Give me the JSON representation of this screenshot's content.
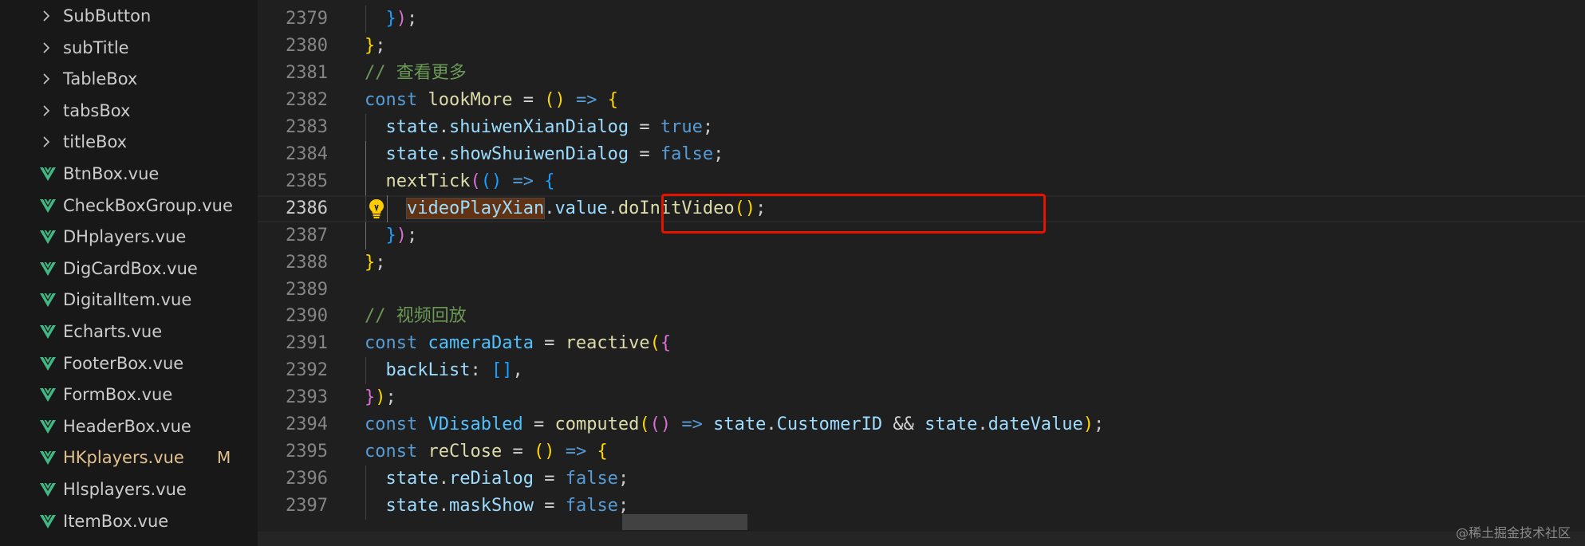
{
  "sidebar": {
    "items": [
      {
        "label": "SubButton",
        "kind": "folder"
      },
      {
        "label": "subTitle",
        "kind": "folder"
      },
      {
        "label": "TableBox",
        "kind": "folder"
      },
      {
        "label": "tabsBox",
        "kind": "folder"
      },
      {
        "label": "titleBox",
        "kind": "folder"
      },
      {
        "label": "BtnBox.vue",
        "kind": "vue"
      },
      {
        "label": "CheckBoxGroup.vue",
        "kind": "vue"
      },
      {
        "label": "DHplayers.vue",
        "kind": "vue"
      },
      {
        "label": "DigCardBox.vue",
        "kind": "vue"
      },
      {
        "label": "DigitalItem.vue",
        "kind": "vue"
      },
      {
        "label": "Echarts.vue",
        "kind": "vue"
      },
      {
        "label": "FooterBox.vue",
        "kind": "vue"
      },
      {
        "label": "FormBox.vue",
        "kind": "vue"
      },
      {
        "label": "HeaderBox.vue",
        "kind": "vue"
      },
      {
        "label": "HKplayers.vue",
        "kind": "vue",
        "modified": true,
        "badge": "M"
      },
      {
        "label": "Hlsplayers.vue",
        "kind": "vue"
      },
      {
        "label": "ItemBox.vue",
        "kind": "vue"
      }
    ]
  },
  "editor": {
    "lines": [
      {
        "n": "2379",
        "indent": 1,
        "tokens": [
          [
            "}",
            "p3"
          ],
          [
            ")",
            "p2"
          ],
          [
            ";",
            "pl"
          ]
        ]
      },
      {
        "n": "2380",
        "indent": 0,
        "tokens": [
          [
            "}",
            "p1"
          ],
          [
            ";",
            "pl"
          ]
        ]
      },
      {
        "n": "2381",
        "indent": 0,
        "tokens": [
          [
            "// 查看更多",
            "cm"
          ]
        ]
      },
      {
        "n": "2382",
        "indent": 0,
        "tokens": [
          [
            "const",
            "kw"
          ],
          [
            " ",
            "pl"
          ],
          [
            "lookMore",
            "fn"
          ],
          [
            " = ",
            "op"
          ],
          [
            "()",
            "p1"
          ],
          [
            " ",
            "pl"
          ],
          [
            "=>",
            "kw"
          ],
          [
            " ",
            "pl"
          ],
          [
            "{",
            "p1"
          ]
        ]
      },
      {
        "n": "2383",
        "indent": 1,
        "tokens": [
          [
            "state",
            "var"
          ],
          [
            ".",
            "pl"
          ],
          [
            "shuiwenXianDialog",
            "var"
          ],
          [
            " = ",
            "op"
          ],
          [
            "true",
            "kw"
          ],
          [
            ";",
            "pl"
          ]
        ]
      },
      {
        "n": "2384",
        "indent": 1,
        "tokens": [
          [
            "state",
            "var"
          ],
          [
            ".",
            "pl"
          ],
          [
            "showShuiwenDialog",
            "var"
          ],
          [
            " = ",
            "op"
          ],
          [
            "false",
            "kw"
          ],
          [
            ";",
            "pl"
          ]
        ]
      },
      {
        "n": "2385",
        "indent": 1,
        "tokens": [
          [
            "nextTick",
            "fn"
          ],
          [
            "(",
            "p2"
          ],
          [
            "()",
            "p3"
          ],
          [
            " ",
            "pl"
          ],
          [
            "=>",
            "kw"
          ],
          [
            " ",
            "pl"
          ],
          [
            "{",
            "p3"
          ]
        ]
      },
      {
        "n": "2386",
        "indent": 2,
        "current": true,
        "tokens": [
          [
            "videoPlayXian",
            "var",
            "hl"
          ],
          [
            ".",
            "pl"
          ],
          [
            "value",
            "var"
          ],
          [
            ".",
            "pl"
          ],
          [
            "doInitVideo",
            "fn"
          ],
          [
            "()",
            "p1"
          ],
          [
            ";",
            "pl"
          ]
        ]
      },
      {
        "n": "2387",
        "indent": 1,
        "tokens": [
          [
            "}",
            "p3"
          ],
          [
            ")",
            "p2"
          ],
          [
            ";",
            "pl"
          ]
        ]
      },
      {
        "n": "2388",
        "indent": 0,
        "tokens": [
          [
            "}",
            "p1"
          ],
          [
            ";",
            "pl"
          ]
        ]
      },
      {
        "n": "2389",
        "indent": 0,
        "tokens": []
      },
      {
        "n": "2390",
        "indent": 0,
        "tokens": [
          [
            "// 视频回放",
            "cm"
          ]
        ]
      },
      {
        "n": "2391",
        "indent": 0,
        "tokens": [
          [
            "const",
            "kw"
          ],
          [
            " ",
            "pl"
          ],
          [
            "cameraData",
            "cst"
          ],
          [
            " = ",
            "op"
          ],
          [
            "reactive",
            "fn"
          ],
          [
            "(",
            "p1"
          ],
          [
            "{",
            "p2"
          ]
        ]
      },
      {
        "n": "2392",
        "indent": 1,
        "tokens": [
          [
            "backList",
            "var"
          ],
          [
            ": ",
            "pl"
          ],
          [
            "[]",
            "p3"
          ],
          [
            ",",
            "pl"
          ]
        ]
      },
      {
        "n": "2393",
        "indent": 0,
        "tokens": [
          [
            "}",
            "p2"
          ],
          [
            ")",
            "p1"
          ],
          [
            ";",
            "pl"
          ]
        ]
      },
      {
        "n": "2394",
        "indent": 0,
        "tokens": [
          [
            "const",
            "kw"
          ],
          [
            " ",
            "pl"
          ],
          [
            "VDisabled",
            "cst"
          ],
          [
            " = ",
            "op"
          ],
          [
            "computed",
            "fn"
          ],
          [
            "(",
            "p1"
          ],
          [
            "()",
            "p2"
          ],
          [
            " ",
            "pl"
          ],
          [
            "=>",
            "kw"
          ],
          [
            " ",
            "pl"
          ],
          [
            "state",
            "var"
          ],
          [
            ".",
            "pl"
          ],
          [
            "CustomerID",
            "var"
          ],
          [
            " && ",
            "op"
          ],
          [
            "state",
            "var"
          ],
          [
            ".",
            "pl"
          ],
          [
            "dateValue",
            "var"
          ],
          [
            ")",
            "p1"
          ],
          [
            ";",
            "pl"
          ]
        ]
      },
      {
        "n": "2395",
        "indent": 0,
        "tokens": [
          [
            "const",
            "kw"
          ],
          [
            " ",
            "pl"
          ],
          [
            "reClose",
            "fn"
          ],
          [
            " = ",
            "op"
          ],
          [
            "()",
            "p1"
          ],
          [
            " ",
            "pl"
          ],
          [
            "=>",
            "kw"
          ],
          [
            " ",
            "pl"
          ],
          [
            "{",
            "p1"
          ]
        ]
      },
      {
        "n": "2396",
        "indent": 1,
        "tokens": [
          [
            "state",
            "var"
          ],
          [
            ".",
            "pl"
          ],
          [
            "reDialog",
            "var"
          ],
          [
            " = ",
            "op"
          ],
          [
            "false",
            "kw"
          ],
          [
            ";",
            "pl"
          ]
        ]
      },
      {
        "n": "2397",
        "indent": 1,
        "tokens": [
          [
            "state",
            "var"
          ],
          [
            ".",
            "pl"
          ],
          [
            "maskShow",
            "var"
          ],
          [
            " = ",
            "op"
          ],
          [
            "false",
            "kw"
          ],
          [
            ";",
            "pl"
          ]
        ]
      }
    ]
  },
  "watermark": "@稀土掘金技术社区",
  "colors": {
    "accent_red": "#e51400",
    "vue_green": "#41b883",
    "modified": "#e2c08d"
  }
}
